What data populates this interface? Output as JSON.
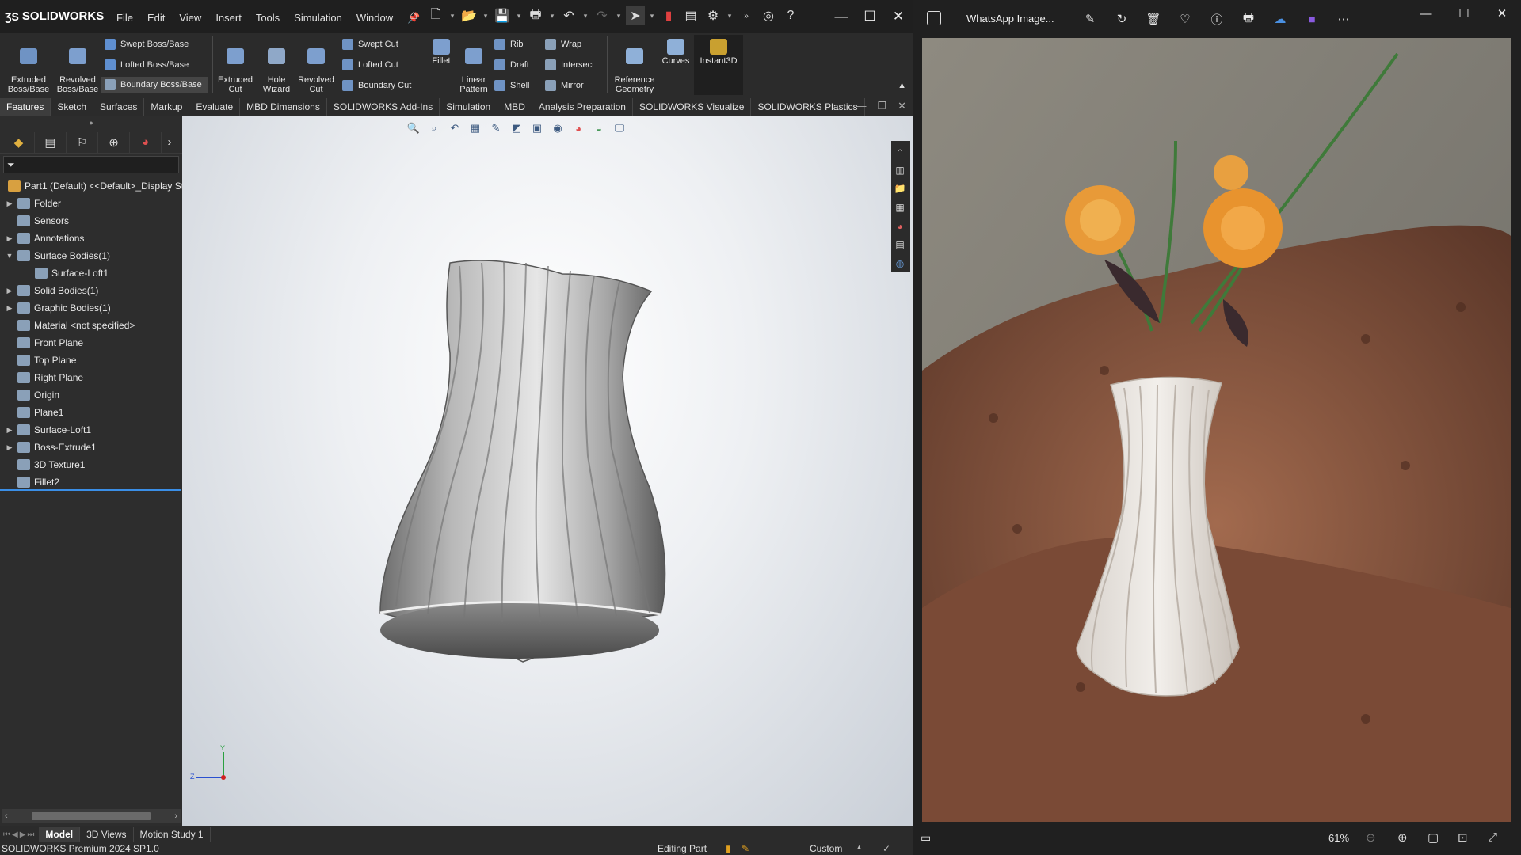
{
  "solidworks": {
    "logo": "SOLIDWORKS",
    "menu": [
      "File",
      "Edit",
      "View",
      "Insert",
      "Tools",
      "Simulation",
      "Window"
    ],
    "ribbon": {
      "extruded_boss": "Extruded\nBoss/Base",
      "revolved_boss": "Revolved\nBoss/Base",
      "swept_boss": "Swept Boss/Base",
      "lofted_boss": "Lofted Boss/Base",
      "boundary_boss": "Boundary Boss/Base",
      "extruded_cut": "Extruded\nCut",
      "hole_wizard": "Hole\nWizard",
      "revolved_cut": "Revolved\nCut",
      "swept_cut": "Swept Cut",
      "lofted_cut": "Lofted Cut",
      "boundary_cut": "Boundary Cut",
      "fillet": "Fillet",
      "linear_pattern": "Linear\nPattern",
      "rib": "Rib",
      "wrap": "Wrap",
      "draft": "Draft",
      "intersect": "Intersect",
      "shell": "Shell",
      "mirror": "Mirror",
      "reference_geometry": "Reference\nGeometry",
      "curves": "Curves",
      "instant3d": "Instant3D"
    },
    "tabs": [
      "Features",
      "Sketch",
      "Surfaces",
      "Markup",
      "Evaluate",
      "MBD Dimensions",
      "SOLIDWORKS Add-Ins",
      "Simulation",
      "MBD",
      "Analysis Preparation",
      "SOLIDWORKS Visualize",
      "SOLIDWORKS Plastics"
    ],
    "active_tab": "Features",
    "tree": [
      {
        "label": "Part1 (Default) <<Default>_Display Sta",
        "arrow": "",
        "indent": 0,
        "root": true
      },
      {
        "label": "Folder",
        "arrow": "▶",
        "indent": 0
      },
      {
        "label": "Sensors",
        "arrow": "",
        "indent": 0
      },
      {
        "label": "Annotations",
        "arrow": "▶",
        "indent": 0
      },
      {
        "label": "Surface Bodies(1)",
        "arrow": "▼",
        "indent": 0
      },
      {
        "label": "Surface-Loft1",
        "arrow": "",
        "indent": 1
      },
      {
        "label": "Solid Bodies(1)",
        "arrow": "▶",
        "indent": 0
      },
      {
        "label": "Graphic Bodies(1)",
        "arrow": "▶",
        "indent": 0
      },
      {
        "label": "Material <not specified>",
        "arrow": "",
        "indent": 0
      },
      {
        "label": "Front Plane",
        "arrow": "",
        "indent": 0
      },
      {
        "label": "Top Plane",
        "arrow": "",
        "indent": 0
      },
      {
        "label": "Right Plane",
        "arrow": "",
        "indent": 0
      },
      {
        "label": "Origin",
        "arrow": "",
        "indent": 0
      },
      {
        "label": "Plane1",
        "arrow": "",
        "indent": 0
      },
      {
        "label": "Surface-Loft1",
        "arrow": "▶",
        "indent": 0
      },
      {
        "label": "Boss-Extrude1",
        "arrow": "▶",
        "indent": 0
      },
      {
        "label": "3D Texture1",
        "arrow": "",
        "indent": 0
      },
      {
        "label": "Fillet2",
        "arrow": "",
        "indent": 0
      }
    ],
    "bottom_tabs": [
      "Model",
      "3D Views",
      "Motion Study 1"
    ],
    "status": {
      "product": "SOLIDWORKS Premium 2024 SP1.0",
      "mode": "Editing Part",
      "units": "Custom"
    },
    "triad": {
      "z": "Z",
      "y": "Y"
    }
  },
  "photos": {
    "title": "WhatsApp Image...",
    "zoom": "61%"
  }
}
